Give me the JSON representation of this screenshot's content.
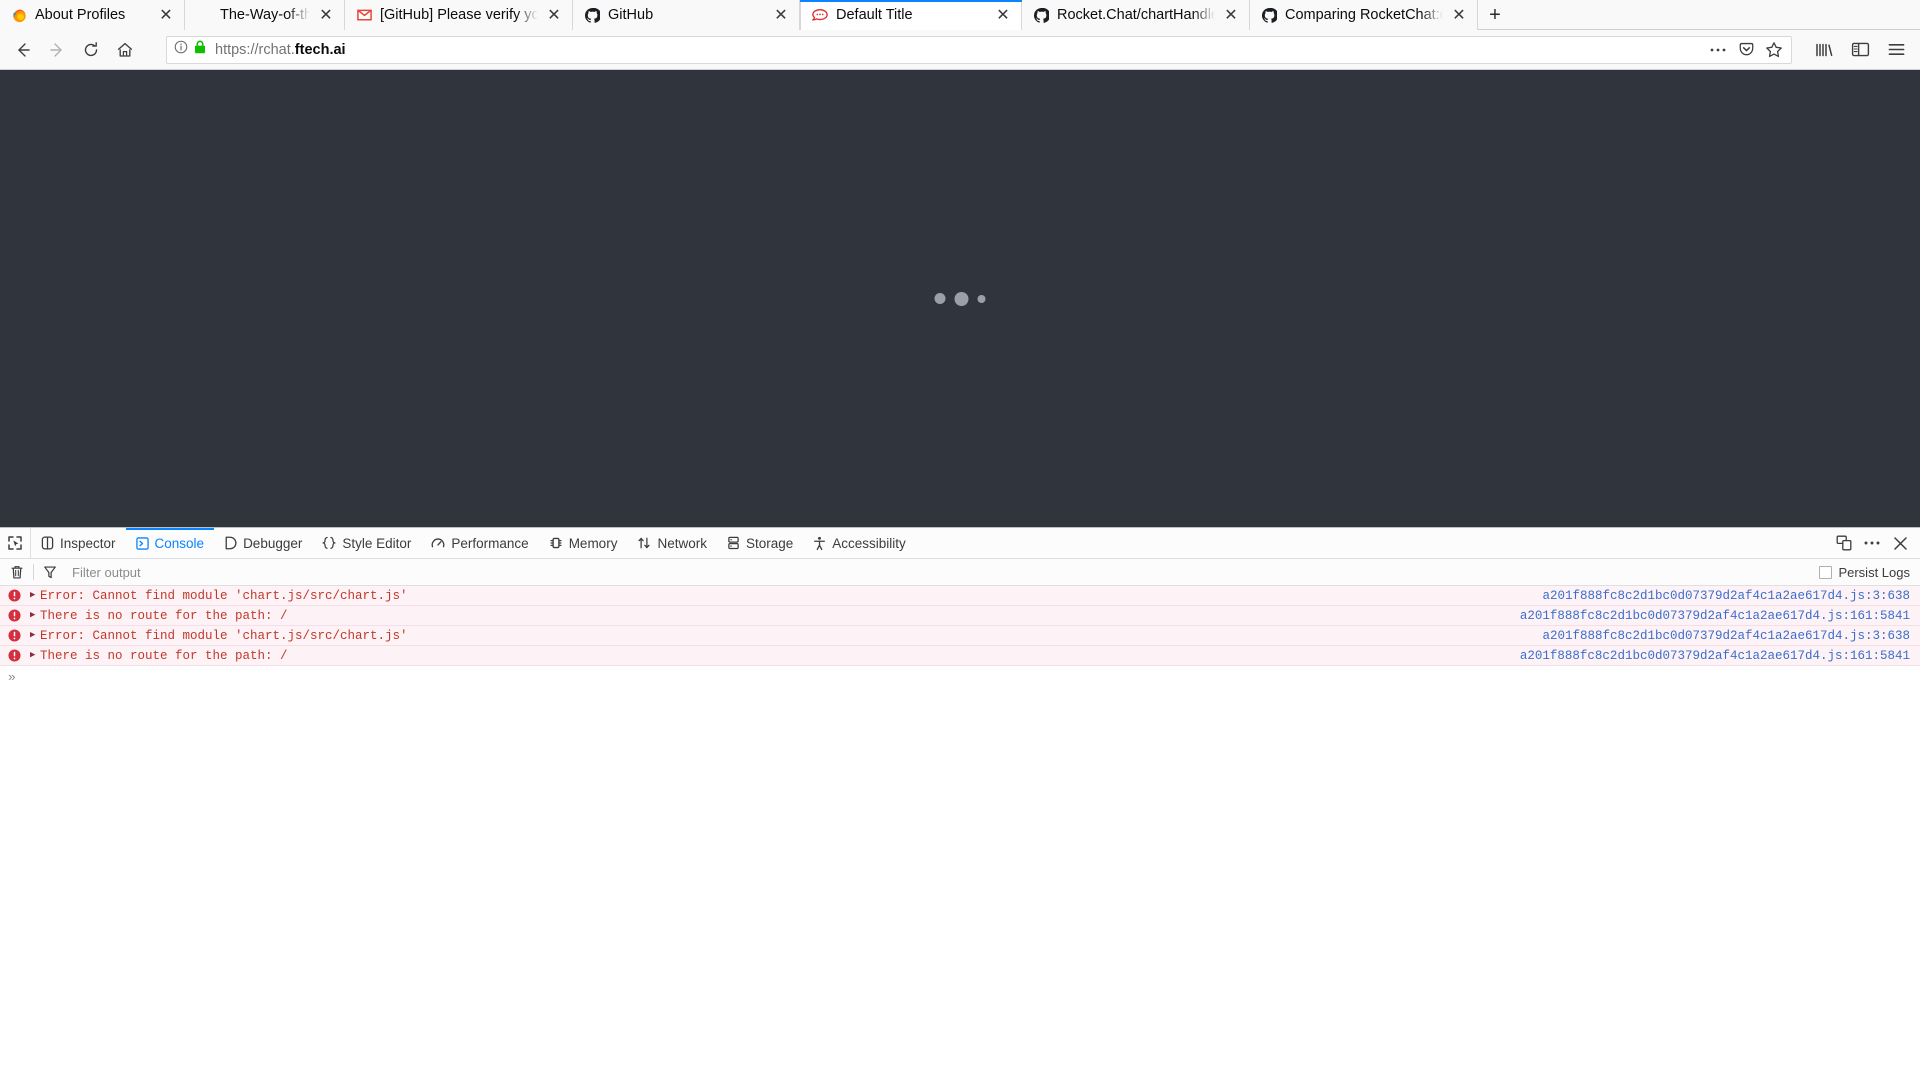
{
  "browser": {
    "tabs": [
      {
        "title": "About Profiles",
        "favicon": "firefox-icon",
        "active": false
      },
      {
        "title": "The-Way-of-the-Superior-M",
        "favicon": "generic-page-icon",
        "active": false
      },
      {
        "title": "[GitHub] Please verify yo",
        "favicon": "gmail-icon",
        "active": false
      },
      {
        "title": "GitHub",
        "favicon": "github-icon",
        "active": false
      },
      {
        "title": "Default Title",
        "favicon": "rocketchat-icon",
        "active": true
      },
      {
        "title": "Rocket.Chat/chartHandle",
        "favicon": "github-icon",
        "active": false
      },
      {
        "title": "Comparing RocketChat:d",
        "favicon": "github-icon",
        "active": false
      }
    ],
    "new_tab_label": "+",
    "close_tab_label": "✕",
    "nav": {
      "back": "back-arrow",
      "forward": "forward-arrow",
      "reload": "reload",
      "home": "home"
    },
    "url": {
      "scheme_host": "https://rchat.",
      "domain": "ftech.ai",
      "identity_icon": "page-info-icon",
      "lock_icon": "secure-lock-icon"
    },
    "urlbar_actions": [
      "page-actions-ellipsis",
      "pocket-icon",
      "bookmark-star-icon"
    ],
    "toolbar_right": [
      "library-icon",
      "sidebar-icon",
      "app-menu-icon"
    ]
  },
  "page": {
    "background_color": "#2f343d",
    "loader": {
      "dots": 3,
      "color": "#9ba0a8"
    }
  },
  "devtools": {
    "picker_icon": "element-picker-icon",
    "tabs": [
      {
        "label": "Inspector",
        "icon": "inspector-icon",
        "active": false
      },
      {
        "label": "Console",
        "icon": "console-icon",
        "active": true
      },
      {
        "label": "Debugger",
        "icon": "debugger-icon",
        "active": false
      },
      {
        "label": "Style Editor",
        "icon": "style-editor-icon",
        "active": false
      },
      {
        "label": "Performance",
        "icon": "performance-icon",
        "active": false
      },
      {
        "label": "Memory",
        "icon": "memory-icon",
        "active": false
      },
      {
        "label": "Network",
        "icon": "network-icon",
        "active": false
      },
      {
        "label": "Storage",
        "icon": "storage-icon",
        "active": false
      },
      {
        "label": "Accessibility",
        "icon": "accessibility-icon",
        "active": false
      }
    ],
    "toolbar_right": [
      "responsive-design-mode-icon",
      "devtools-menu-icon",
      "close-devtools-icon"
    ],
    "filterbar": {
      "clear_icon": "trash-icon",
      "filter_icon": "funnel-icon",
      "filter_value": "",
      "filter_placeholder": "Filter output",
      "persist_label": "Persist Logs",
      "persist_checked": false
    },
    "console": {
      "prompt": "»",
      "messages": [
        {
          "level": "error",
          "text": "Error: Cannot find module 'chart.js/src/chart.js'",
          "source": "a201f888fc8c2d1bc0d07379d2af4c1a2ae617d4.js:3:638"
        },
        {
          "level": "error",
          "text": "There is no route for the path: /",
          "source": "a201f888fc8c2d1bc0d07379d2af4c1a2ae617d4.js:161:5841"
        },
        {
          "level": "error",
          "text": "Error: Cannot find module 'chart.js/src/chart.js'",
          "source": "a201f888fc8c2d1bc0d07379d2af4c1a2ae617d4.js:3:638"
        },
        {
          "level": "error",
          "text": "There is no route for the path: /",
          "source": "a201f888fc8c2d1bc0d07379d2af4c1a2ae617d4.js:161:5841"
        }
      ]
    }
  },
  "colors": {
    "accent": "#0a84ff",
    "error_text": "#c0392b",
    "error_bg": "#fdf2f5",
    "link": "#3b6ecc"
  }
}
